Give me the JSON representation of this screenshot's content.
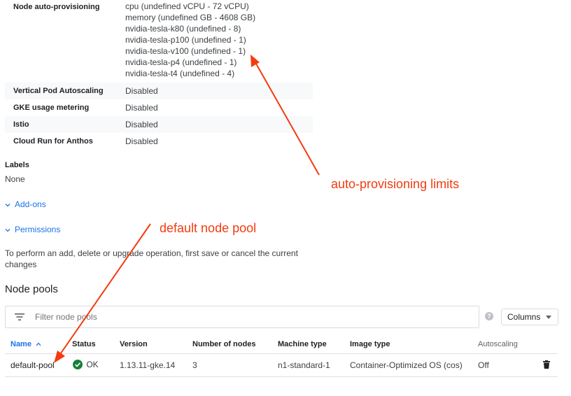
{
  "details": {
    "autoprovisioning": {
      "label": "Node auto-provisioning",
      "lines": [
        "cpu (undefined vCPU - 72 vCPU)",
        "memory (undefined GB - 4608 GB)",
        "nvidia-tesla-k80 (undefined - 8)",
        "nvidia-tesla-p100 (undefined - 1)",
        "nvidia-tesla-v100 (undefined - 1)",
        "nvidia-tesla-p4 (undefined - 1)",
        "nvidia-tesla-t4 (undefined - 4)"
      ]
    },
    "rows": [
      {
        "label": "Vertical Pod Autoscaling",
        "value": "Disabled"
      },
      {
        "label": "GKE usage metering",
        "value": "Disabled"
      },
      {
        "label": "Istio",
        "value": "Disabled"
      },
      {
        "label": "Cloud Run for Anthos",
        "value": "Disabled"
      }
    ]
  },
  "labels": {
    "title": "Labels",
    "value": "None"
  },
  "addons_link": "Add-ons",
  "permissions_link": "Permissions",
  "info_text": "To perform an add, delete or upgrade operation, first save or cancel the current changes",
  "node_pools": {
    "title": "Node pools",
    "filter_placeholder": "Filter node pools",
    "columns_button": "Columns",
    "headers": {
      "name": "Name",
      "status": "Status",
      "version": "Version",
      "nodes": "Number of nodes",
      "machine": "Machine type",
      "image": "Image type",
      "autoscaling": "Autoscaling"
    },
    "row": {
      "name": "default-pool",
      "status": "OK",
      "version": "1.13.11-gke.14",
      "nodes": "3",
      "machine": "n1-standard-1",
      "image": "Container-Optimized OS (cos)",
      "autoscaling": "Off"
    }
  },
  "annotations": {
    "autoprov": "auto-provisioning limits",
    "default_pool": "default node pool"
  },
  "colors": {
    "link": "#1a73e8",
    "ok": "#188038",
    "annotation": "#f43b0f"
  }
}
